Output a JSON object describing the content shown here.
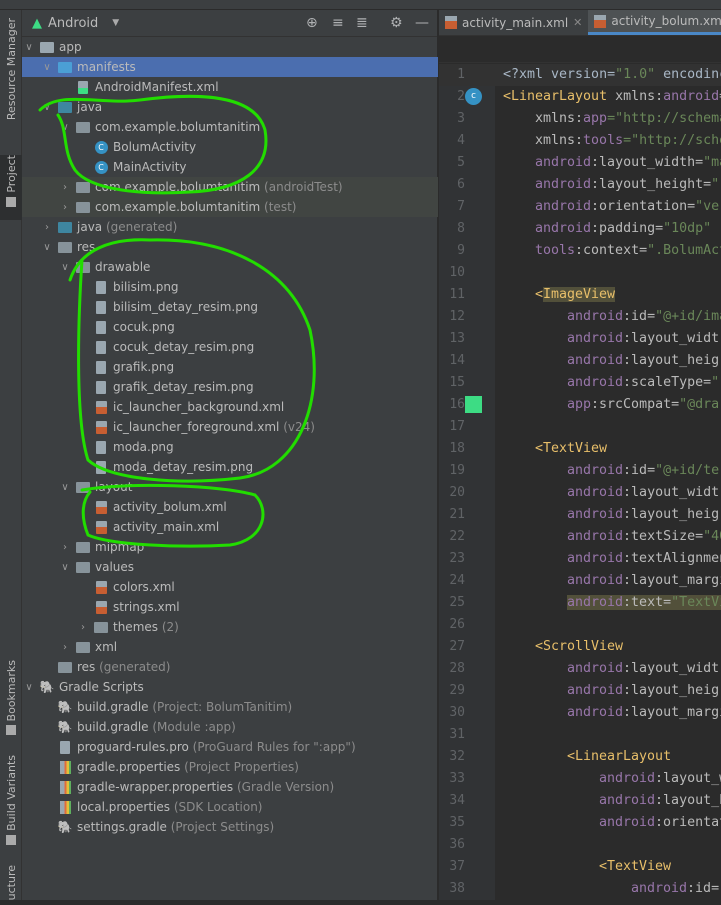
{
  "left_stripe": {
    "resource_manager": "Resource Manager",
    "project": "Project",
    "bookmarks": "Bookmarks",
    "build_variants": "Build Variants",
    "structure": "ucture"
  },
  "project_panel": {
    "view_selector": "Android",
    "tree": [
      {
        "label": "app",
        "sub": "",
        "level": 0,
        "icon": "module",
        "chevron": "open"
      },
      {
        "label": "manifests",
        "sub": "",
        "level": 1,
        "icon": "folder-blue",
        "chevron": "open",
        "state": "selected"
      },
      {
        "label": "AndroidManifest.xml",
        "sub": "",
        "level": 2,
        "icon": "manifest-file"
      },
      {
        "label": "java",
        "sub": "",
        "level": 1,
        "icon": "folder-java",
        "chevron": "open"
      },
      {
        "label": "com.example.bolumtanitim",
        "sub": "",
        "level": 2,
        "icon": "package",
        "chevron": "open"
      },
      {
        "label": "BolumActivity",
        "sub": "",
        "level": 3,
        "icon": "class"
      },
      {
        "label": "MainActivity",
        "sub": "",
        "level": 3,
        "icon": "class"
      },
      {
        "label": "com.example.bolumtanitim",
        "sub": " (androidTest)",
        "level": 2,
        "icon": "package",
        "chevron": "closed",
        "state": "test"
      },
      {
        "label": "com.example.bolumtanitim",
        "sub": " (test)",
        "level": 2,
        "icon": "package",
        "chevron": "closed",
        "state": "test"
      },
      {
        "label": "java",
        "sub": " (generated)",
        "level": 1,
        "icon": "folder-java",
        "chevron": "closed"
      },
      {
        "label": "res",
        "sub": "",
        "level": 1,
        "icon": "folder",
        "chevron": "open"
      },
      {
        "label": "drawable",
        "sub": "",
        "level": 2,
        "icon": "folder",
        "chevron": "open"
      },
      {
        "label": "bilisim.png",
        "sub": "",
        "level": 3,
        "icon": "file"
      },
      {
        "label": "bilisim_detay_resim.png",
        "sub": "",
        "level": 3,
        "icon": "file"
      },
      {
        "label": "cocuk.png",
        "sub": "",
        "level": 3,
        "icon": "file"
      },
      {
        "label": "cocuk_detay_resim.png",
        "sub": "",
        "level": 3,
        "icon": "file"
      },
      {
        "label": "grafik.png",
        "sub": "",
        "level": 3,
        "icon": "file"
      },
      {
        "label": "grafik_detay_resim.png",
        "sub": "",
        "level": 3,
        "icon": "file"
      },
      {
        "label": "ic_launcher_background.xml",
        "sub": "",
        "level": 3,
        "icon": "xml-file"
      },
      {
        "label": "ic_launcher_foreground.xml",
        "sub": " (v24)",
        "level": 3,
        "icon": "xml-file"
      },
      {
        "label": "moda.png",
        "sub": "",
        "level": 3,
        "icon": "file"
      },
      {
        "label": "moda_detay_resim.png",
        "sub": "",
        "level": 3,
        "icon": "file"
      },
      {
        "label": "layout",
        "sub": "",
        "level": 2,
        "icon": "folder",
        "chevron": "open"
      },
      {
        "label": "activity_bolum.xml",
        "sub": "",
        "level": 3,
        "icon": "xml-file"
      },
      {
        "label": "activity_main.xml",
        "sub": "",
        "level": 3,
        "icon": "xml-file"
      },
      {
        "label": "mipmap",
        "sub": "",
        "level": 2,
        "icon": "folder",
        "chevron": "closed"
      },
      {
        "label": "values",
        "sub": "",
        "level": 2,
        "icon": "folder",
        "chevron": "open"
      },
      {
        "label": "colors.xml",
        "sub": "",
        "level": 3,
        "icon": "xml-file"
      },
      {
        "label": "strings.xml",
        "sub": "",
        "level": 3,
        "icon": "xml-file"
      },
      {
        "label": "themes",
        "sub": " (2)",
        "level": 3,
        "icon": "folder",
        "chevron": "closed"
      },
      {
        "label": "xml",
        "sub": "",
        "level": 2,
        "icon": "folder",
        "chevron": "closed"
      },
      {
        "label": "res",
        "sub": " (generated)",
        "level": 1,
        "icon": "folder-generated"
      },
      {
        "label": "Gradle Scripts",
        "sub": "",
        "level": 0,
        "icon": "gradle",
        "chevron": "open"
      },
      {
        "label": "build.gradle",
        "sub": " (Project: BolumTanitim)",
        "level": 1,
        "icon": "gradle"
      },
      {
        "label": "build.gradle",
        "sub": " (Module :app)",
        "level": 1,
        "icon": "gradle"
      },
      {
        "label": "proguard-rules.pro",
        "sub": " (ProGuard Rules for \":app\")",
        "level": 1,
        "icon": "file"
      },
      {
        "label": "gradle.properties",
        "sub": " (Project Properties)",
        "level": 1,
        "icon": "properties"
      },
      {
        "label": "gradle-wrapper.properties",
        "sub": " (Gradle Version)",
        "level": 1,
        "icon": "properties"
      },
      {
        "label": "local.properties",
        "sub": " (SDK Location)",
        "level": 1,
        "icon": "properties"
      },
      {
        "label": "settings.gradle",
        "sub": " (Project Settings)",
        "level": 1,
        "icon": "gradle"
      }
    ]
  },
  "editor": {
    "tabs": [
      {
        "label": "activity_main.xml",
        "active": false
      },
      {
        "label": "activity_bolum.xml",
        "active": true
      }
    ],
    "lines": [
      {
        "n": "1",
        "i": 0,
        "k": [
          [
            "<?xml version=",
            "p"
          ],
          [
            "\"1.0\"",
            "s"
          ],
          [
            " encodinc",
            "p"
          ]
        ],
        "current": true
      },
      {
        "n": "2",
        "i": 0,
        "k": [
          [
            "<LinearLayout ",
            "t"
          ],
          [
            "xmlns:",
            "n"
          ],
          [
            "android",
            "a"
          ],
          [
            "=",
            "n"
          ]
        ],
        "mark": "class"
      },
      {
        "n": "3",
        "i": 4,
        "k": [
          [
            "xmlns:",
            "n"
          ],
          [
            "app",
            "a"
          ],
          [
            "=\"http://schema",
            "s"
          ]
        ]
      },
      {
        "n": "4",
        "i": 4,
        "k": [
          [
            "xmlns:",
            "n"
          ],
          [
            "tools",
            "a"
          ],
          [
            "=\"http://sche",
            "s"
          ]
        ]
      },
      {
        "n": "5",
        "i": 4,
        "k": [
          [
            "android",
            "a"
          ],
          [
            ":layout_width=",
            "n"
          ],
          [
            "\"ma",
            "s"
          ]
        ]
      },
      {
        "n": "6",
        "i": 4,
        "k": [
          [
            "android",
            "a"
          ],
          [
            ":layout_height=",
            "n"
          ],
          [
            "\"",
            "s"
          ]
        ]
      },
      {
        "n": "7",
        "i": 4,
        "k": [
          [
            "android",
            "a"
          ],
          [
            ":orientation=",
            "n"
          ],
          [
            "\"ver",
            "s"
          ]
        ]
      },
      {
        "n": "8",
        "i": 4,
        "k": [
          [
            "android",
            "a"
          ],
          [
            ":padding=",
            "n"
          ],
          [
            "\"10dp\"",
            "s"
          ]
        ]
      },
      {
        "n": "9",
        "i": 4,
        "k": [
          [
            "tools",
            "a"
          ],
          [
            ":context=",
            "n"
          ],
          [
            "\".BolumAct",
            "s"
          ]
        ]
      },
      {
        "n": "10",
        "i": 0,
        "k": []
      },
      {
        "n": "11",
        "i": 4,
        "k": [
          [
            "<",
            "t"
          ],
          [
            "ImageView",
            "t hl"
          ]
        ]
      },
      {
        "n": "12",
        "i": 8,
        "k": [
          [
            "android",
            "a"
          ],
          [
            ":id=",
            "n"
          ],
          [
            "\"@+id/ima",
            "s"
          ]
        ]
      },
      {
        "n": "13",
        "i": 8,
        "k": [
          [
            "android",
            "a"
          ],
          [
            ":layout_widt",
            "n"
          ]
        ]
      },
      {
        "n": "14",
        "i": 8,
        "k": [
          [
            "android",
            "a"
          ],
          [
            ":layout_heig",
            "n"
          ]
        ]
      },
      {
        "n": "15",
        "i": 8,
        "k": [
          [
            "android",
            "a"
          ],
          [
            ":scaleType=",
            "n"
          ],
          [
            "\"",
            "s"
          ]
        ]
      },
      {
        "n": "16",
        "i": 8,
        "k": [
          [
            "app",
            "a"
          ],
          [
            ":srcCompat=",
            "n"
          ],
          [
            "\"@dra",
            "s"
          ]
        ],
        "mark": "color"
      },
      {
        "n": "17",
        "i": 0,
        "k": []
      },
      {
        "n": "18",
        "i": 4,
        "k": [
          [
            "<TextView",
            "t"
          ]
        ]
      },
      {
        "n": "19",
        "i": 8,
        "k": [
          [
            "android",
            "a"
          ],
          [
            ":id=",
            "n"
          ],
          [
            "\"@+id/te",
            "s"
          ]
        ]
      },
      {
        "n": "20",
        "i": 8,
        "k": [
          [
            "android",
            "a"
          ],
          [
            ":layout_widt",
            "n"
          ]
        ]
      },
      {
        "n": "21",
        "i": 8,
        "k": [
          [
            "android",
            "a"
          ],
          [
            ":layout_heig",
            "n"
          ]
        ]
      },
      {
        "n": "22",
        "i": 8,
        "k": [
          [
            "android",
            "a"
          ],
          [
            ":textSize=",
            "n"
          ],
          [
            "\"40",
            "s"
          ]
        ]
      },
      {
        "n": "23",
        "i": 8,
        "k": [
          [
            "android",
            "a"
          ],
          [
            ":textAlignmen",
            "n"
          ]
        ]
      },
      {
        "n": "24",
        "i": 8,
        "k": [
          [
            "android",
            "a"
          ],
          [
            ":layout_margi",
            "n"
          ]
        ]
      },
      {
        "n": "25",
        "i": 8,
        "k": [
          [
            "android",
            "a hl"
          ],
          [
            ":text=",
            "n hl"
          ],
          [
            "\"TextVi",
            "s hl"
          ]
        ]
      },
      {
        "n": "26",
        "i": 0,
        "k": []
      },
      {
        "n": "27",
        "i": 4,
        "k": [
          [
            "<ScrollView",
            "t"
          ]
        ]
      },
      {
        "n": "28",
        "i": 8,
        "k": [
          [
            "android",
            "a"
          ],
          [
            ":layout_widt",
            "n"
          ]
        ]
      },
      {
        "n": "29",
        "i": 8,
        "k": [
          [
            "android",
            "a"
          ],
          [
            ":layout_heig",
            "n"
          ]
        ]
      },
      {
        "n": "30",
        "i": 8,
        "k": [
          [
            "android",
            "a"
          ],
          [
            ":layout_margi",
            "n"
          ]
        ]
      },
      {
        "n": "31",
        "i": 0,
        "k": []
      },
      {
        "n": "32",
        "i": 8,
        "k": [
          [
            "<LinearLayout",
            "t"
          ]
        ]
      },
      {
        "n": "33",
        "i": 12,
        "k": [
          [
            "android",
            "a"
          ],
          [
            ":layout_w",
            "n"
          ]
        ]
      },
      {
        "n": "34",
        "i": 12,
        "k": [
          [
            "android",
            "a"
          ],
          [
            ":layout_h",
            "n"
          ]
        ]
      },
      {
        "n": "35",
        "i": 12,
        "k": [
          [
            "android",
            "a"
          ],
          [
            ":orientat",
            "n"
          ]
        ]
      },
      {
        "n": "36",
        "i": 0,
        "k": []
      },
      {
        "n": "37",
        "i": 12,
        "k": [
          [
            "<TextView",
            "t"
          ]
        ]
      },
      {
        "n": "38",
        "i": 16,
        "k": [
          [
            "android",
            "a"
          ],
          [
            ":id=",
            "n"
          ]
        ]
      }
    ],
    "color_swatch": "#3ddc84"
  },
  "annotation_color": "#22dd00"
}
